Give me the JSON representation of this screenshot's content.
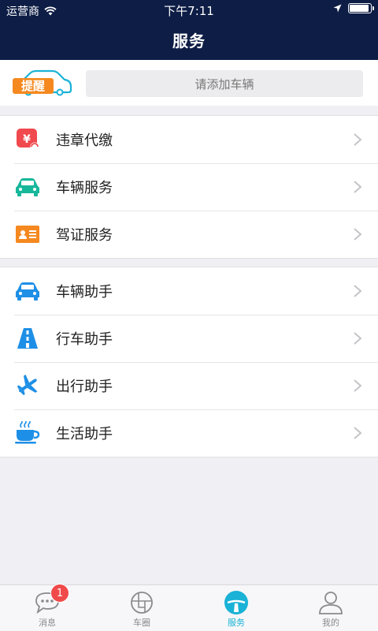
{
  "status_bar": {
    "carrier": "运营商",
    "time": "下午7:11",
    "battery_level": 0.95
  },
  "header": {
    "title": "服务"
  },
  "reminder": {
    "logo_text": "提醒",
    "add_vehicle_prompt": "请添加车辆"
  },
  "groups": [
    {
      "items": [
        {
          "label": "违章代缴",
          "icon": "violation-payment-icon"
        },
        {
          "label": "车辆服务",
          "icon": "car-service-icon"
        },
        {
          "label": "驾证服务",
          "icon": "license-card-icon"
        }
      ]
    },
    {
      "items": [
        {
          "label": "车辆助手",
          "icon": "car-assistant-icon"
        },
        {
          "label": "行车助手",
          "icon": "road-icon"
        },
        {
          "label": "出行助手",
          "icon": "airplane-icon"
        },
        {
          "label": "生活助手",
          "icon": "coffee-cup-icon"
        }
      ]
    }
  ],
  "tabbar": {
    "tabs": [
      {
        "label": "消息",
        "badge": "1"
      },
      {
        "label": "车圈"
      },
      {
        "label": "服务",
        "active": true
      },
      {
        "label": "我的"
      }
    ]
  },
  "colors": {
    "header_bg": "#0d1d45",
    "accent": "#1ab2d6",
    "logo_orange": "#f5891f",
    "badge_red": "#f04a4a"
  }
}
